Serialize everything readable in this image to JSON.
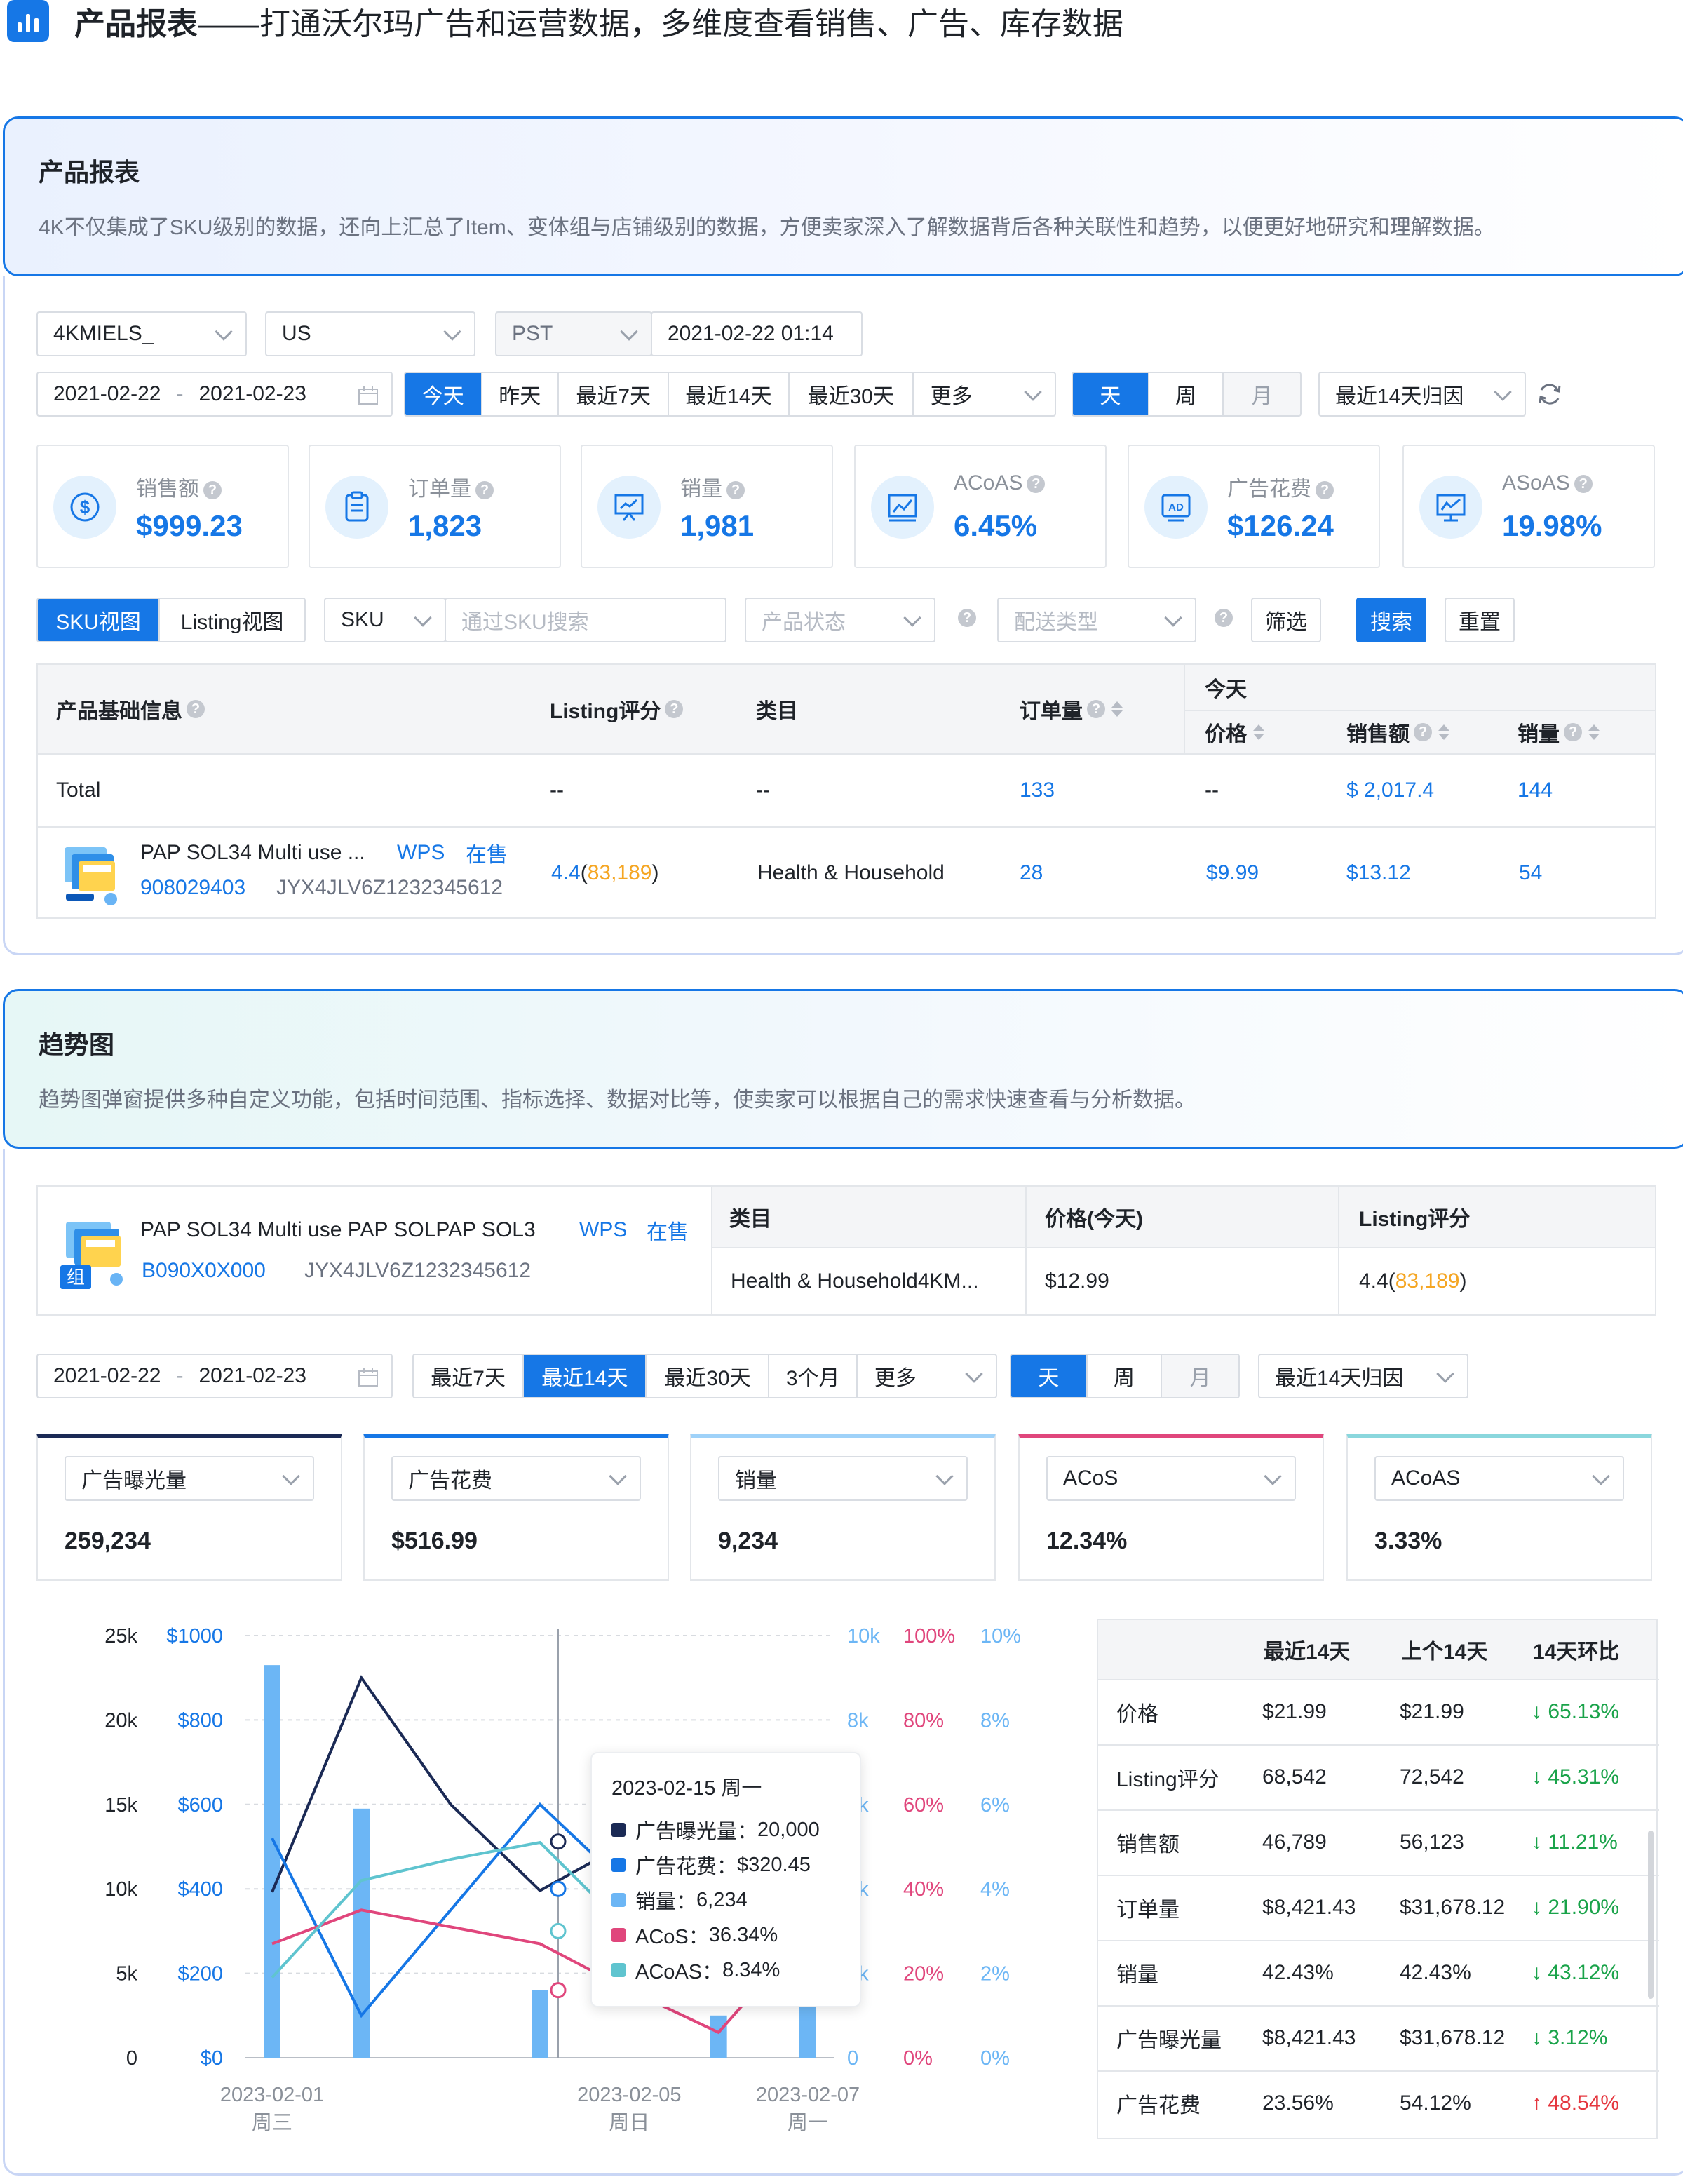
{
  "page_title": {
    "bold": "产品报表",
    "rest": "——打通沃尔玛广告和运营数据，多维度查看销售、广告、库存数据"
  },
  "intro1": {
    "title": "产品报表",
    "desc": "4K不仅集成了SKU级别的数据，还向上汇总了Item、变体组与店铺级别的数据，方便卖家深入了解数据背后各种关联性和趋势，以便更好地研究和理解数据。"
  },
  "filters": {
    "store": "4KMIELS_",
    "market": "US",
    "timezone": "PST",
    "datetime": "2021-02-22 01:14",
    "date_from": "2021-02-22",
    "date_sep": "-",
    "date_to": "2021-02-23",
    "ranges": [
      "今天",
      "昨天",
      "最近7天",
      "最近14天",
      "最近30天",
      "更多"
    ],
    "granularity": [
      "天",
      "周",
      "月"
    ],
    "attribution": "最近14天归因"
  },
  "kpis": [
    {
      "label": "销售额",
      "value": "$999.23",
      "icon": "dollar-icon"
    },
    {
      "label": "订单量",
      "value": "1,823",
      "icon": "clipboard-icon"
    },
    {
      "label": "销量",
      "value": "1,981",
      "icon": "presentation-icon"
    },
    {
      "label": "ACoAS",
      "value": "6.45%",
      "icon": "chart-icon"
    },
    {
      "label": "广告花费",
      "value": "$126.24",
      "icon": "ad-icon"
    },
    {
      "label": "ASoAS",
      "value": "19.98%",
      "icon": "trend-icon"
    }
  ],
  "toolbar": {
    "view_sku": "SKU视图",
    "view_listing": "Listing视图",
    "search_type": "SKU",
    "search_placeholder": "通过SKU搜索",
    "status_placeholder": "产品状态",
    "ship_placeholder": "配送类型",
    "filter": "筛选",
    "search": "搜索",
    "reset": "重置"
  },
  "table": {
    "h_info": "产品基础信息",
    "h_rating": "Listing评分",
    "h_cat": "类目",
    "h_orders": "订单量",
    "h_today": "今天",
    "h_price": "价格",
    "h_sales": "销售额",
    "h_units": "销量",
    "total": {
      "label": "Total",
      "rating": "--",
      "cat": "--",
      "orders": "133",
      "price": "--",
      "sales": "$ 2,017.4",
      "units": "144"
    },
    "row": {
      "name": "PAP SOL34 Multi use ...",
      "tag1": "WPS",
      "tag2": "在售",
      "id": "908029403",
      "sku": "JYX4JLV6Z1232345612",
      "rating": "4.4",
      "rating_count": "83,189",
      "paren_l": "(",
      "paren_r": ")",
      "cat": "Health & Household",
      "orders": "28",
      "price": "$9.99",
      "sales": "$13.12",
      "units": "54"
    }
  },
  "intro2": {
    "title": "趋势图",
    "desc": "趋势图弹窗提供多种自定义功能，包括时间范围、指标选择、数据对比等，使卖家可以根据自己的需求快速查看与分析数据。"
  },
  "product2": {
    "name": "PAP SOL34 Multi use PAP SOLPAP SOL3",
    "tag1": "WPS",
    "tag2": "在售",
    "id": "B090X0X000",
    "sku": "JYX4JLV6Z1232345612",
    "badge": "组",
    "h_cat": "类目",
    "h_price": "价格(今天)",
    "h_rating": "Listing评分",
    "cat": "Health & Household4KM...",
    "price": "$12.99",
    "rating": "4.4",
    "rating_count": "83,189",
    "paren_l": "(",
    "paren_r": ")"
  },
  "filters2": {
    "date_from": "2021-02-22",
    "date_sep": "-",
    "date_to": "2021-02-23",
    "ranges": [
      "最近7天",
      "最近14天",
      "最近30天",
      "3个月",
      "更多"
    ],
    "granularity": [
      "天",
      "周",
      "月"
    ],
    "attribution": "最近14天归因"
  },
  "metrics": [
    {
      "label": "广告曝光量",
      "value": "259,234",
      "color": "#1b2a55"
    },
    {
      "label": "广告花费",
      "value": "$516.99",
      "color": "#1677e6"
    },
    {
      "label": "销量",
      "value": "9,234",
      "color": "#6cb6f5"
    },
    {
      "label": "ACoS",
      "value": "12.34%",
      "color": "#e0467c"
    },
    {
      "label": "ACoAS",
      "value": "3.33%",
      "color": "#5fc4cf"
    }
  ],
  "chart_data": {
    "type": "line",
    "x": [
      "2023-02-01",
      "2023-02-02",
      "2023-02-03",
      "2023-02-04",
      "2023-02-05",
      "2023-02-06",
      "2023-02-07"
    ],
    "tick_labels": [
      {
        "date": "2023-02-01",
        "day": "周三"
      },
      {
        "date": "2023-02-05",
        "day": "周日"
      },
      {
        "date": "2023-02-07",
        "day": "周一"
      }
    ],
    "axes": {
      "impressions": {
        "ticks": [
          "25k",
          "20k",
          "15k",
          "10k",
          "5k",
          "0"
        ],
        "ylim": [
          0,
          25000
        ]
      },
      "spend": {
        "ticks": [
          "$1000",
          "$800",
          "$600",
          "$400",
          "$200",
          "$0"
        ],
        "ylim": [
          0,
          1000
        ]
      },
      "units": {
        "ticks": [
          "10k",
          "8k",
          "6k",
          "4k",
          "2k",
          "0"
        ],
        "ylim": [
          0,
          10000
        ]
      },
      "acos": {
        "ticks": [
          "100%",
          "80%",
          "60%",
          "40%",
          "20%",
          "0%"
        ],
        "ylim": [
          0,
          100
        ]
      },
      "acoas": {
        "ticks": [
          "10%",
          "8%",
          "6%",
          "4%",
          "2%",
          "0%"
        ],
        "ylim": [
          0,
          10
        ]
      }
    },
    "series": [
      {
        "name": "销量",
        "kind": "bar",
        "axis": "units",
        "color": "#6cb6f5",
        "values": [
          9300,
          5900,
          null,
          1600,
          null,
          1000,
          1200
        ]
      },
      {
        "name": "广告曝光量",
        "kind": "line",
        "axis": "impressions",
        "color": "#1b2a55",
        "values": [
          9800,
          22500,
          15000,
          9900,
          12800,
          null,
          null
        ]
      },
      {
        "name": "广告花费",
        "kind": "line",
        "axis": "spend",
        "color": "#1677e6",
        "values": [
          520,
          100,
          350,
          600,
          400,
          200,
          560
        ]
      },
      {
        "name": "ACoS",
        "kind": "line",
        "axis": "acos",
        "color": "#e0467c",
        "values": [
          27,
          35,
          31,
          27,
          16,
          6,
          30
        ]
      },
      {
        "name": "ACoAS",
        "kind": "line",
        "axis": "acoas",
        "color": "#5fc4cf",
        "values": [
          1.9,
          4.2,
          4.7,
          5.1,
          3.0,
          null,
          null
        ]
      }
    ],
    "tooltip": {
      "title": "2023-02-15 周一",
      "rows": [
        {
          "label": "广告曝光量：",
          "value": "20,000",
          "color": "#1b2a55"
        },
        {
          "label": "广告花费：",
          "value": "$320.45",
          "color": "#1677e6"
        },
        {
          "label": "销量：",
          "value": "6,234",
          "color": "#6cb6f5"
        },
        {
          "label": "ACoS：",
          "value": "36.34%",
          "color": "#e0467c"
        },
        {
          "label": "ACoAS：",
          "value": "8.34%",
          "color": "#5fc4cf"
        }
      ]
    }
  },
  "compare": {
    "headers": [
      "最近14天",
      "上个14天",
      "14天环比"
    ],
    "rows": [
      {
        "label": "价格",
        "a": "$21.99",
        "b": "$21.99",
        "c": "↓ 65.13%",
        "up": false
      },
      {
        "label": "Listing评分",
        "a": "68,542",
        "b": "72,542",
        "c": "↓ 45.31%",
        "up": false
      },
      {
        "label": "销售额",
        "a": "46,789",
        "b": "56,123",
        "c": "↓ 11.21%",
        "up": false
      },
      {
        "label": "订单量",
        "a": "$8,421.43",
        "b": "$31,678.12",
        "c": "↓ 21.90%",
        "up": false
      },
      {
        "label": "销量",
        "a": "42.43%",
        "b": "42.43%",
        "c": "↓ 43.12%",
        "up": false
      },
      {
        "label": "广告曝光量",
        "a": "$8,421.43",
        "b": "$31,678.12",
        "c": "↓ 3.12%",
        "up": false
      },
      {
        "label": "广告花费",
        "a": "23.56%",
        "b": "54.12%",
        "c": "↑ 48.54%",
        "up": true
      }
    ]
  }
}
